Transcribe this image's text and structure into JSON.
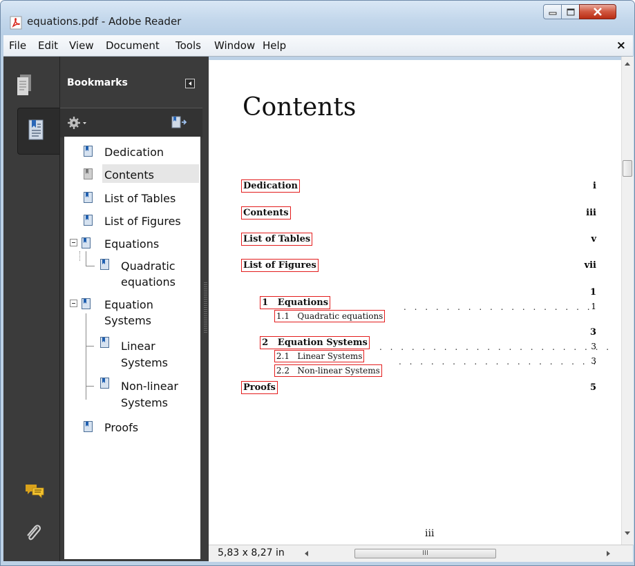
{
  "window": {
    "title": "equations.pdf - Adobe Reader"
  },
  "menu": {
    "items": [
      "File",
      "Edit",
      "View",
      "Document",
      "Tools",
      "Window",
      "Help"
    ],
    "close_symbol": "×"
  },
  "bookmarks": {
    "title": "Bookmarks",
    "items": [
      {
        "label": "Dedication"
      },
      {
        "label": "Contents",
        "selected": true
      },
      {
        "label": "List of Tables"
      },
      {
        "label": "List of Figures"
      },
      {
        "label": "Equations",
        "expanded": true,
        "children": [
          {
            "label_lines": [
              "Quadratic",
              "equations"
            ]
          }
        ]
      },
      {
        "label_lines": [
          "Equation",
          "Systems"
        ],
        "expanded": true,
        "children": [
          {
            "label_lines": [
              "Linear",
              "Systems"
            ]
          },
          {
            "label_lines": [
              "Non-linear",
              "Systems"
            ]
          }
        ]
      },
      {
        "label": "Proofs"
      }
    ]
  },
  "document": {
    "heading": "Contents",
    "toc": [
      {
        "label": "Dedication",
        "page": "i"
      },
      {
        "label": "Contents",
        "page": "iii"
      },
      {
        "label": "List of Tables",
        "page": "v"
      },
      {
        "label": "List of Figures",
        "page": "vii"
      },
      {
        "label": "1   Equations",
        "page": "1"
      },
      {
        "label": "1.1   Quadratic equations",
        "page": "1"
      },
      {
        "label": "2   Equation Systems",
        "page": "3"
      },
      {
        "label": "2.1   Linear Systems",
        "page": "3"
      },
      {
        "label": "2.2   Non-linear Systems",
        "page": "3"
      },
      {
        "label": "Proofs",
        "page": "5"
      }
    ],
    "footer_page": "iii"
  },
  "status": {
    "page_size": "5,83 x 8,27 in",
    "scroll_thumb_grip": "III"
  },
  "colors": {
    "link_border": "#e31b1b",
    "panel_dark": "#3b3b3b",
    "close_button": "#c7462c"
  }
}
